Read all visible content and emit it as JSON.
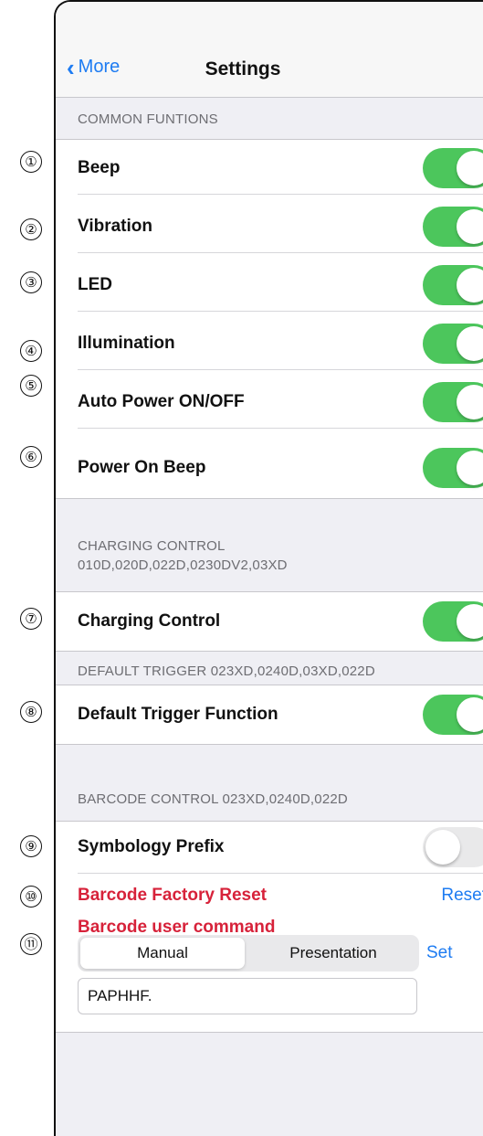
{
  "navbar": {
    "back_label": "More",
    "title": "Settings"
  },
  "markers": [
    "①",
    "②",
    "③",
    "④",
    "⑤",
    "⑥",
    "⑦",
    "⑧",
    "⑨",
    "⑩",
    "⑪"
  ],
  "common": {
    "header": "COMMON FUNTIONS",
    "rows": [
      {
        "label": "Beep",
        "on": true
      },
      {
        "label": "Vibration",
        "on": true
      },
      {
        "label": "LED",
        "on": true
      },
      {
        "label": "Illumination",
        "on": true
      },
      {
        "label": "Auto Power ON/OFF",
        "on": true
      },
      {
        "label": "Power On Beep",
        "on": true
      }
    ]
  },
  "charging": {
    "header_line1": "CHARGING CONTROL",
    "header_line2": "010D,020D,022D,0230DV2,03XD",
    "row": {
      "label": "Charging Control",
      "on": true
    }
  },
  "trigger": {
    "header": "DEFAULT TRIGGER 023XD,0240D,03XD,022D",
    "row": {
      "label": "Default Trigger Function",
      "on": true
    }
  },
  "barcode": {
    "header": "BARCODE CONTROL  023XD,0240D,022D",
    "prefix": {
      "label": "Symbology Prefix",
      "on": false
    },
    "reset": {
      "label": "Barcode Factory Reset",
      "action": "Reset"
    },
    "command": {
      "label": "Barcode user command",
      "segments": [
        "Manual",
        "Presentation"
      ],
      "selected": "Manual",
      "set_label": "Set",
      "input_value": "PAPHHF."
    }
  },
  "colors": {
    "accent": "#1e7cf2",
    "toggle_on": "#4cc65c",
    "warning_red": "#d7223a"
  }
}
